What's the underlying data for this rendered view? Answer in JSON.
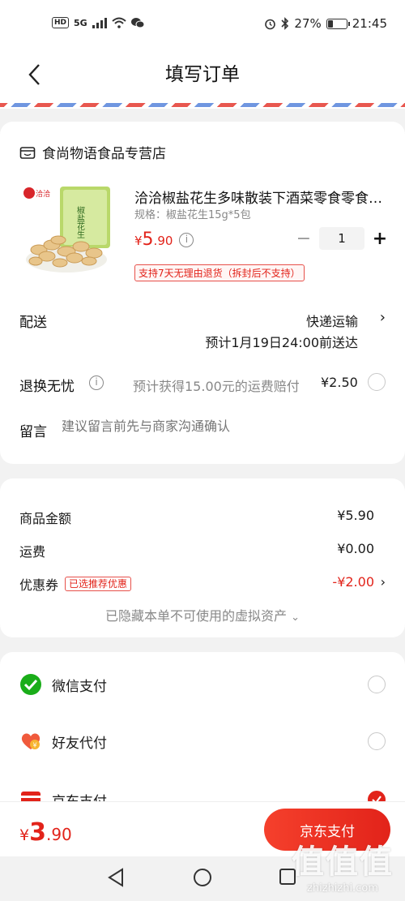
{
  "status_bar": {
    "hd": "HD",
    "network": "5G",
    "battery": "27%",
    "time": "21:45"
  },
  "nav": {
    "title": "填写订单"
  },
  "store": {
    "name": "食尚物语食品专营店"
  },
  "product": {
    "title": "洽洽椒盐花生多味散装下酒菜零食零食零食小吃",
    "spec": "规格：椒盐花生15g*5包",
    "price_currency": "¥",
    "price_int": "5",
    "price_dec": ".90",
    "quantity": "1",
    "return_tag": "支持7天无理由退货（拆封后不支持）",
    "image_brand": "洽洽",
    "image_pack_text": "椒盐花生"
  },
  "delivery": {
    "label": "配送",
    "method": "快递运输",
    "eta": "预计1月19日24:00前送达"
  },
  "return_insurance": {
    "label": "退换无忧",
    "text": "预计获得15.00元的运费赔付",
    "price": "¥2.50"
  },
  "message": {
    "label": "留言",
    "placeholder": "建议留言前先与商家沟通确认"
  },
  "amounts": {
    "goods_label": "商品金额",
    "goods_value": "¥5.90",
    "shipping_label": "运费",
    "shipping_value": "¥0.00",
    "coupon_label": "优惠券",
    "coupon_tag": "已选推荐优惠",
    "coupon_value": "-¥2.00",
    "hidden_note": "已隐藏本单不可使用的虚拟资产"
  },
  "payment": {
    "wechat": "微信支付",
    "friend": "好友代付",
    "jd": "京东支付"
  },
  "bottom": {
    "currency": "¥",
    "total_int": "3",
    "total_dec": ".90",
    "pay_button": "京东支付"
  },
  "watermark": {
    "logo": "值值值",
    "url": "zhizhizhi.com"
  },
  "colors": {
    "accent": "#e2231a",
    "wechat": "#1aad19",
    "background": "#f2f2f2"
  }
}
